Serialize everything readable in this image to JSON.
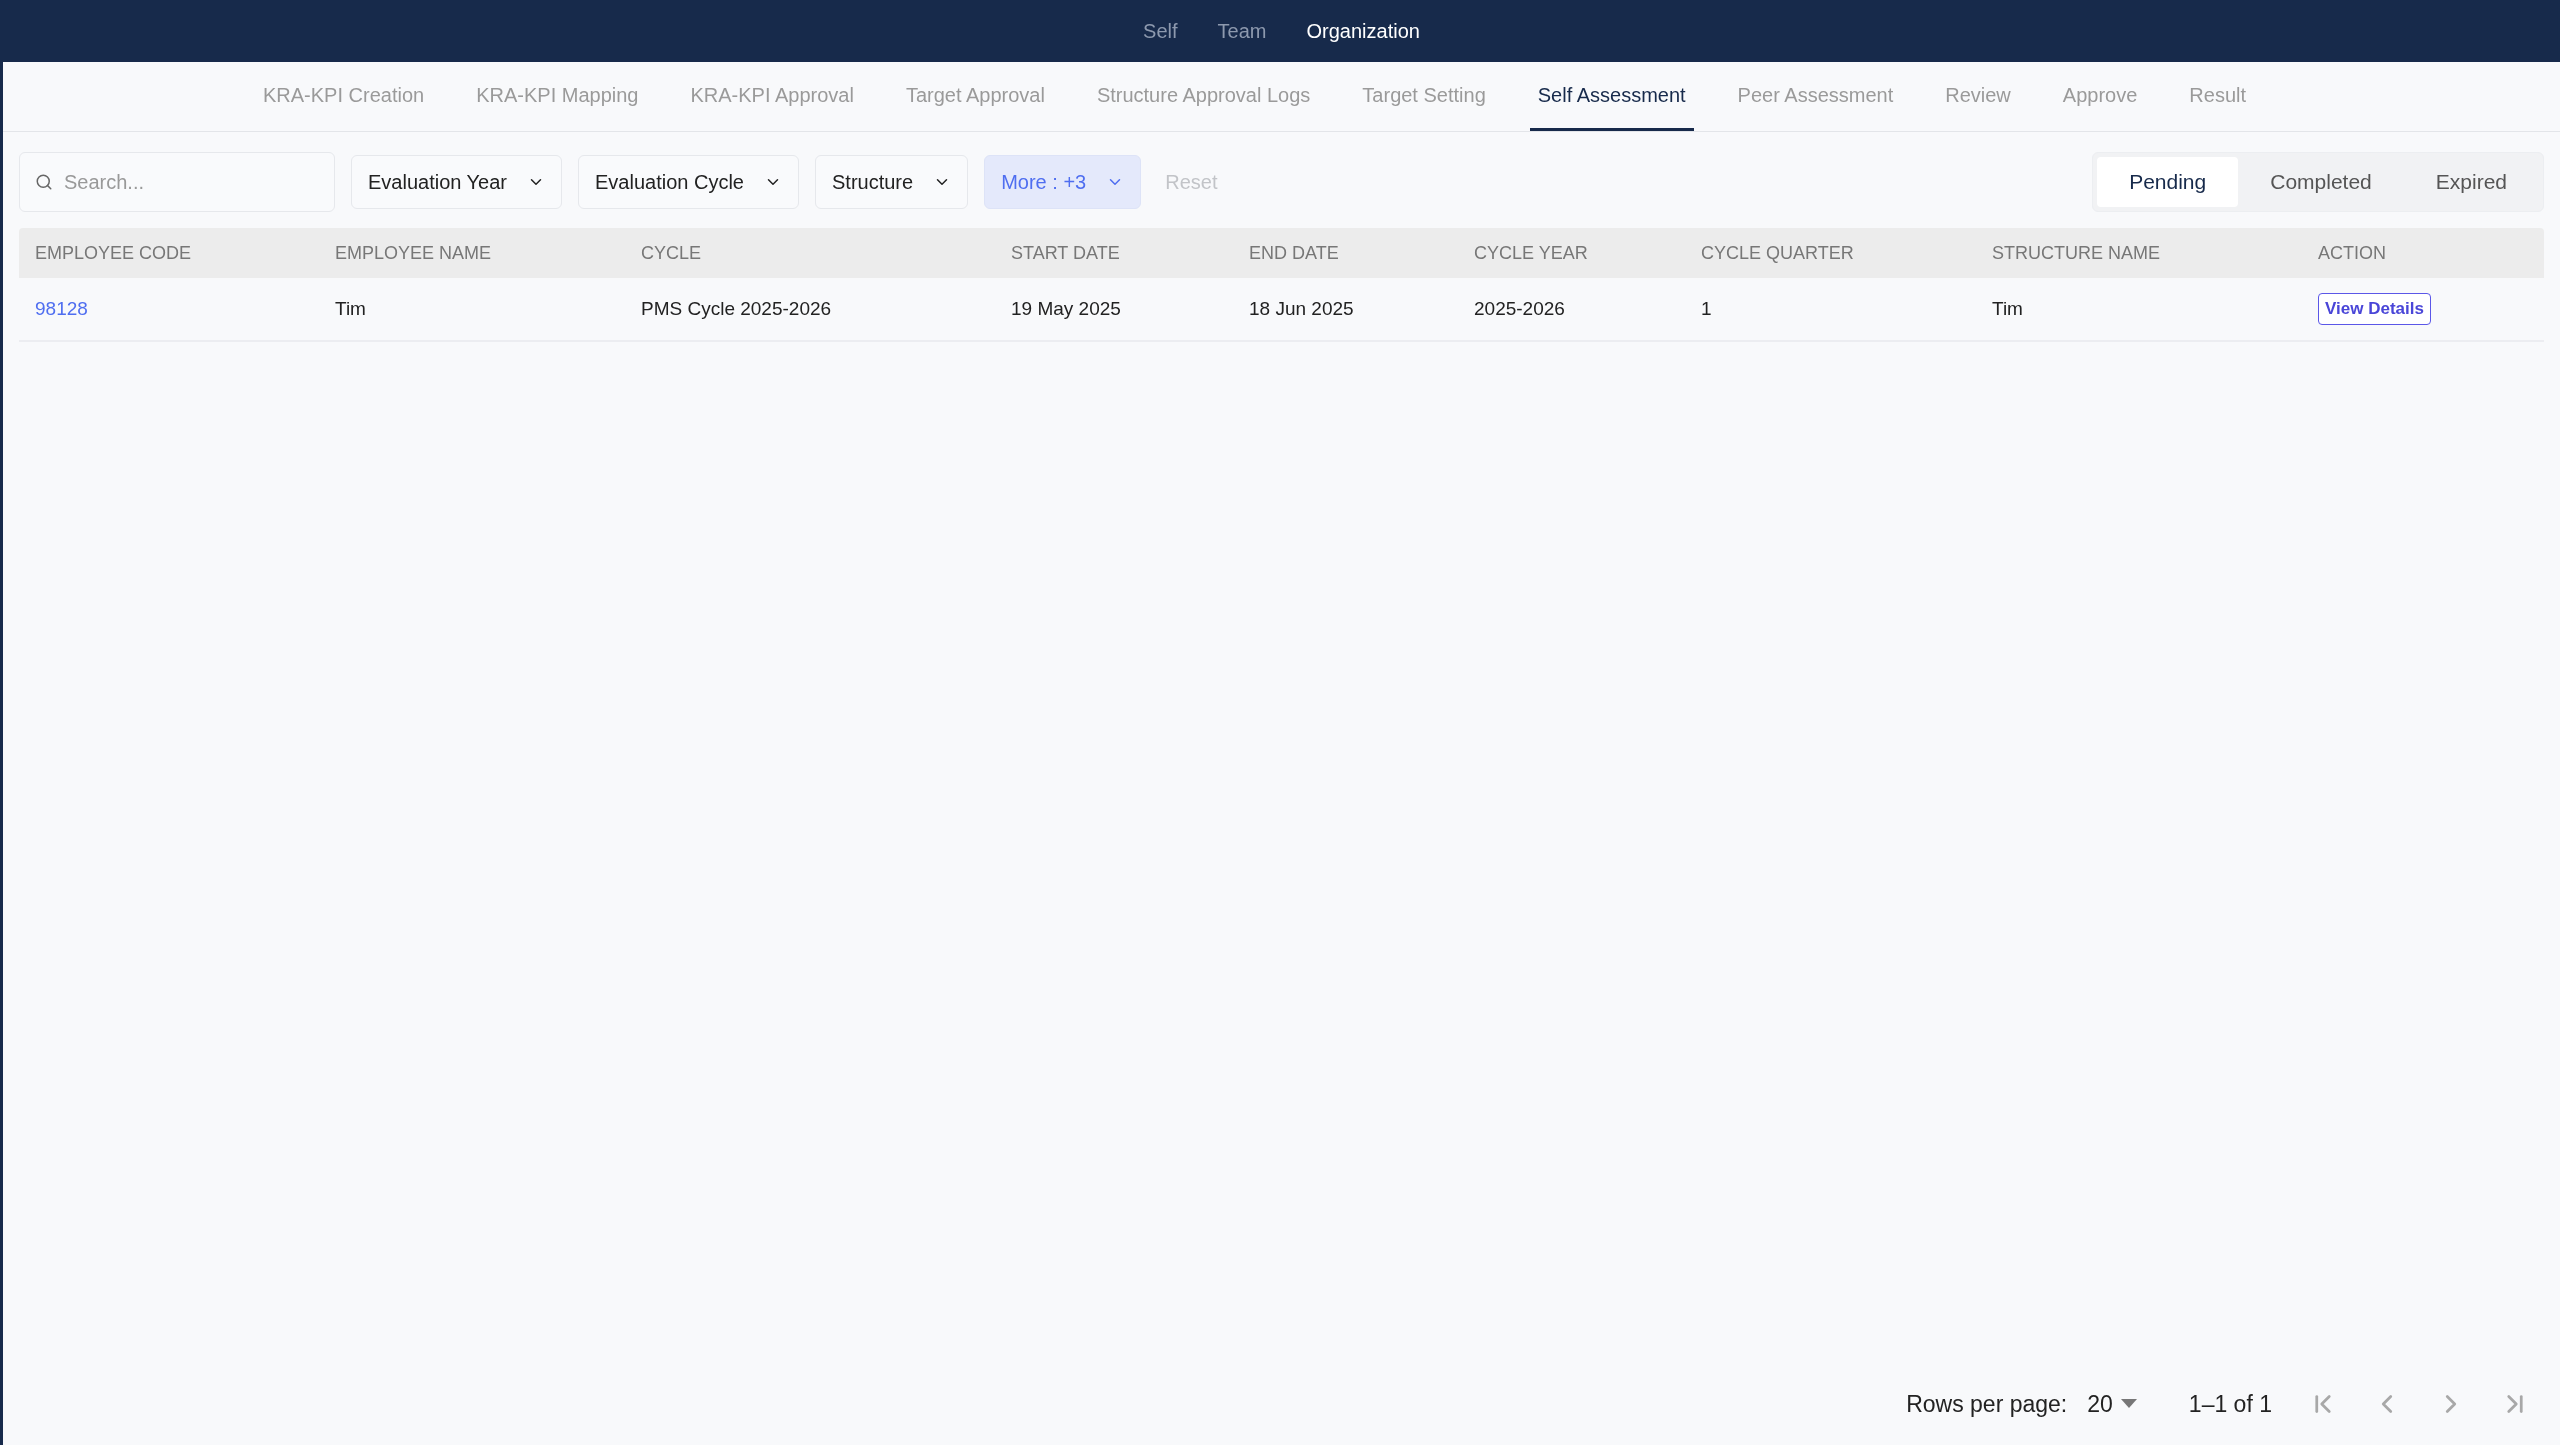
{
  "top_nav": [
    {
      "label": "Self",
      "selected": false
    },
    {
      "label": "Team",
      "selected": false
    },
    {
      "label": "Organization",
      "selected": true
    }
  ],
  "tabs": [
    {
      "label": "KRA-KPI Creation",
      "selected": false
    },
    {
      "label": "KRA-KPI Mapping",
      "selected": false
    },
    {
      "label": "KRA-KPI Approval",
      "selected": false
    },
    {
      "label": "Target Approval",
      "selected": false
    },
    {
      "label": "Structure Approval Logs",
      "selected": false
    },
    {
      "label": "Target Setting",
      "selected": false
    },
    {
      "label": "Self Assessment",
      "selected": true
    },
    {
      "label": "Peer Assessment",
      "selected": false
    },
    {
      "label": "Review",
      "selected": false
    },
    {
      "label": "Approve",
      "selected": false
    },
    {
      "label": "Result",
      "selected": false
    }
  ],
  "search": {
    "placeholder": "Search..."
  },
  "filters": [
    {
      "kind": "dropdown",
      "label": "Evaluation Year",
      "active": false
    },
    {
      "kind": "dropdown",
      "label": "Evaluation Cycle",
      "active": false
    },
    {
      "kind": "dropdown",
      "label": "Structure",
      "active": false
    },
    {
      "kind": "dropdown",
      "label": "More : +3",
      "active": true
    },
    {
      "kind": "reset",
      "label": "Reset",
      "disabled": true
    }
  ],
  "status_tabs": [
    {
      "label": "Pending",
      "selected": true
    },
    {
      "label": "Completed",
      "selected": false
    },
    {
      "label": "Expired",
      "selected": false
    }
  ],
  "table": {
    "columns": [
      "EMPLOYEE CODE",
      "EMPLOYEE NAME",
      "CYCLE",
      "START DATE",
      "END DATE",
      "CYCLE YEAR",
      "CYCLE QUARTER",
      "STRUCTURE NAME",
      "ACTION"
    ],
    "rows": [
      [
        {
          "kind": "link",
          "text": "98128"
        },
        {
          "kind": "text",
          "text": "Tim"
        },
        {
          "kind": "text",
          "text": "PMS Cycle 2025-2026"
        },
        {
          "kind": "text",
          "text": "19 May 2025"
        },
        {
          "kind": "text",
          "text": "18 Jun 2025"
        },
        {
          "kind": "text",
          "text": "2025-2026"
        },
        {
          "kind": "text",
          "text": "1"
        },
        {
          "kind": "text",
          "text": "Tim"
        },
        {
          "kind": "button",
          "text": "View Details"
        }
      ]
    ]
  },
  "pagination": {
    "rows_label": "Rows per page:",
    "rows_value": "20",
    "range": "1–1 of 1",
    "buttons": [
      {
        "kind": "first",
        "disabled": true
      },
      {
        "kind": "prev",
        "disabled": true
      },
      {
        "kind": "next",
        "disabled": true
      },
      {
        "kind": "last",
        "disabled": true
      }
    ]
  }
}
